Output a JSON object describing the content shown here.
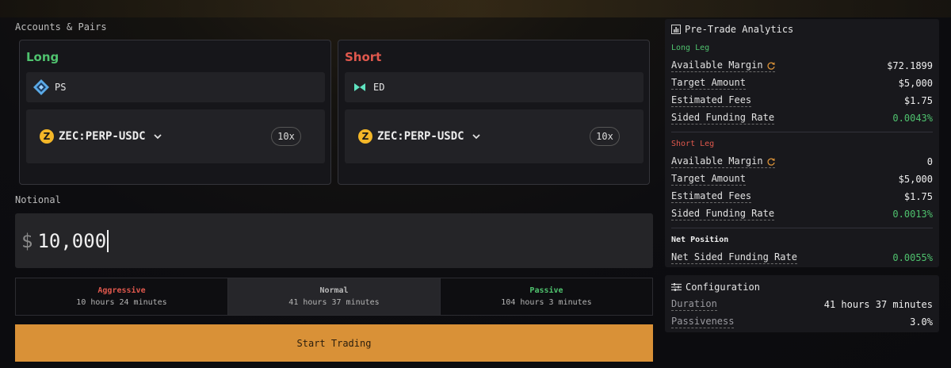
{
  "accounts_label": "Accounts & Pairs",
  "long": {
    "side": "Long",
    "exchange": "PS",
    "market": "ZEC:PERP-USDC",
    "market_icon": "Z",
    "leverage": "10x",
    "color": "#4fc26e"
  },
  "short": {
    "side": "Short",
    "exchange": "ED",
    "market": "ZEC:PERP-USDC",
    "market_icon": "Z",
    "leverage": "10x",
    "color": "#e0584d"
  },
  "notional": {
    "label": "Notional",
    "currency": "$",
    "value": "10,000"
  },
  "speeds": [
    {
      "title": "Aggressive",
      "duration": "10 hours 24 minutes",
      "color": "#e0584d",
      "active": false
    },
    {
      "title": "Normal",
      "duration": "41 hours 37 minutes",
      "color": "#b8b8b8",
      "active": true
    },
    {
      "title": "Passive",
      "duration": "104 hours 3 minutes",
      "color": "#4fc26e",
      "active": false
    }
  ],
  "start_button": "Start Trading",
  "analytics": {
    "title": "Pre-Trade Analytics",
    "long_leg": {
      "heading": "Long Leg",
      "rows": [
        {
          "label": "Available Margin",
          "value": "$72.1899"
        },
        {
          "label": "Target Amount",
          "value": "$5,000"
        },
        {
          "label": "Estimated Fees",
          "value": "$1.75"
        },
        {
          "label": "Sided Funding Rate",
          "value": "0.0043%"
        }
      ]
    },
    "short_leg": {
      "heading": "Short Leg",
      "rows": [
        {
          "label": "Available Margin",
          "value": "0"
        },
        {
          "label": "Target Amount",
          "value": "$5,000"
        },
        {
          "label": "Estimated Fees",
          "value": "$1.75"
        },
        {
          "label": "Sided Funding Rate",
          "value": "0.0013%"
        }
      ]
    },
    "net": {
      "heading": "Net Position",
      "label": "Net Sided Funding Rate",
      "value": "0.0055%"
    }
  },
  "configuration": {
    "title": "Configuration",
    "rows": [
      {
        "label": "Duration",
        "value": "41 hours 37 minutes"
      },
      {
        "label": "Passiveness",
        "value": "3.0%"
      }
    ]
  }
}
